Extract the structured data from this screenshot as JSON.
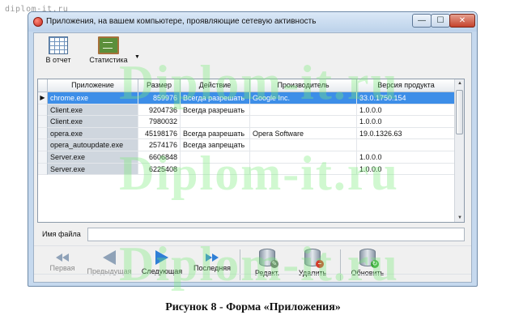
{
  "watermark_top": "diplom-it.ru",
  "watermark_text": "Diplom-it.ru",
  "window": {
    "title": "Приложения, на вашем компьютере, проявляющие сетевую активность",
    "controls": {
      "minimize": "—",
      "maximize": "☐",
      "close": "✕"
    }
  },
  "toolbar": {
    "report_label": "В отчет",
    "stats_label": "Статистика",
    "dropdown_glyph": "▼"
  },
  "table": {
    "columns": [
      "Приложение",
      "Размер",
      "Действие",
      "Производитель",
      "Версия продукта"
    ],
    "rows": [
      {
        "app": "chrome.exe",
        "size": "859976",
        "action": "Всегда разрешать",
        "vendor": "Google Inc.",
        "version": "33.0.1750.154",
        "selected": true
      },
      {
        "app": "Client.exe",
        "size": "9204736",
        "action": "Всегда разрешать",
        "vendor": "",
        "version": "1.0.0.0"
      },
      {
        "app": "Client.exe",
        "size": "7980032",
        "action": "",
        "vendor": "",
        "version": "1.0.0.0"
      },
      {
        "app": "opera.exe",
        "size": "45198176",
        "action": "Всегда разрешать",
        "vendor": "Opera Software",
        "version": "19.0.1326.63"
      },
      {
        "app": "opera_autoupdate.exe",
        "size": "2574176",
        "action": "Всегда запрещать",
        "vendor": "",
        "version": ""
      },
      {
        "app": "Server.exe",
        "size": "6606848",
        "action": "",
        "vendor": "",
        "version": "1.0.0.0"
      },
      {
        "app": "Server.exe",
        "size": "6225408",
        "action": "",
        "vendor": "",
        "version": "1.0.0.0"
      }
    ],
    "row_indicator": "▶"
  },
  "file": {
    "label": "Имя файла",
    "value": ""
  },
  "nav": {
    "first": "Первая",
    "prev": "Предыдущая",
    "next": "Следующая",
    "last": "Последняя",
    "edit": "Редакт.",
    "delete": "Удалить",
    "refresh": "Обновить"
  },
  "caption": "Рисунок 8 - Форма «Приложения»",
  "colors": {
    "selection": "#3d8ee8",
    "nav_enabled": "#2f7fd6",
    "nav_disabled": "#8fa2b8"
  }
}
